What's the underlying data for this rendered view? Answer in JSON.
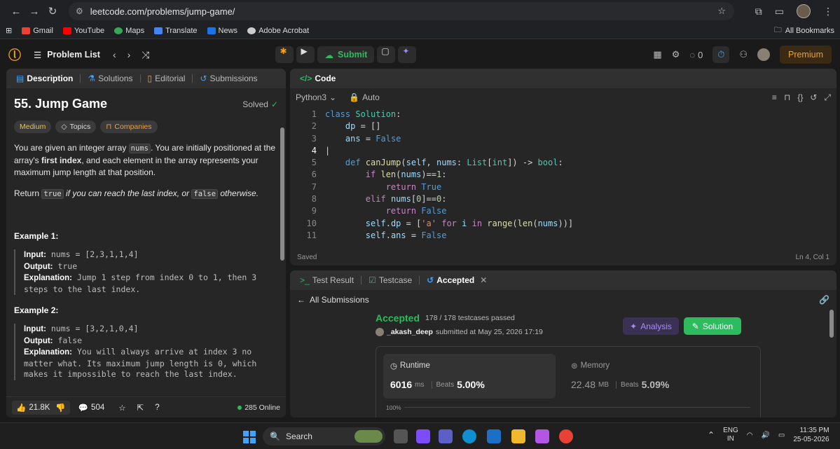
{
  "browser": {
    "url": "leetcode.com/problems/jump-game/",
    "bookmarks": [
      "Gmail",
      "YouTube",
      "Maps",
      "Translate",
      "News",
      "Adobe Acrobat"
    ],
    "all_bookmarks": "All Bookmarks"
  },
  "header": {
    "problem_list": "Problem List",
    "submit": "Submit",
    "streak": "0",
    "premium": "Premium"
  },
  "left_panel": {
    "tabs": [
      "Description",
      "Solutions",
      "Editorial",
      "Submissions"
    ],
    "title": "55. Jump Game",
    "solved": "Solved",
    "tags": [
      "Medium",
      "Topics",
      "Companies"
    ],
    "desc1_a": "You are given an integer array ",
    "desc1_code": "nums",
    "desc1_b": ". You are initially positioned at the array's ",
    "desc1_bold": "first index",
    "desc1_c": ", and each element in the array represents your maximum jump length at that position.",
    "desc2_a": "Return ",
    "desc2_code1": "true",
    "desc2_b": " if you can reach the last index, or ",
    "desc2_code2": "false",
    "desc2_c": " otherwise.",
    "example1": {
      "heading": "Example 1:",
      "input_label": "Input:",
      "input": "nums = [2,3,1,1,4]",
      "output_label": "Output:",
      "output": "true",
      "expl_label": "Explanation:",
      "expl": "Jump 1 step from index 0 to 1, then 3 steps to the last index."
    },
    "example2": {
      "heading": "Example 2:",
      "input_label": "Input:",
      "input": "nums = [3,2,1,0,4]",
      "output_label": "Output:",
      "output": "false",
      "expl_label": "Explanation:",
      "expl": "You will always arrive at index 3 no matter what. Its maximum jump length is 0, which makes it impossible to reach the last index."
    },
    "footer": {
      "likes": "21.8K",
      "comments": "504",
      "online": "285 Online"
    }
  },
  "editor": {
    "tab": "Code",
    "language": "Python3",
    "auto": "Auto",
    "status": "Saved",
    "cursor": "Ln 4, Col 1",
    "lines": [
      "1",
      "2",
      "3",
      "4",
      "5",
      "6",
      "7",
      "8",
      "9",
      "10",
      "11"
    ]
  },
  "result": {
    "tabs": [
      "Test Result",
      "Testcase",
      "Accepted"
    ],
    "back": "All Submissions",
    "status": "Accepted",
    "passed": "178 / 178 testcases passed",
    "user": "_akash_deep",
    "submitted": "submitted at May 25, 2026 17:19",
    "analysis": "Analysis",
    "solution": "Solution",
    "runtime": {
      "label": "Runtime",
      "value": "6016",
      "unit": "ms",
      "beats_label": "Beats",
      "beats": "5.00%"
    },
    "memory": {
      "label": "Memory",
      "value": "22.48",
      "unit": "MB",
      "beats_label": "Beats",
      "beats": "5.09%"
    },
    "chart_label": "100%"
  },
  "taskbar": {
    "search": "Search",
    "lang1": "ENG",
    "lang2": "IN",
    "time": "11:35 PM",
    "date": "25-05-2026"
  }
}
